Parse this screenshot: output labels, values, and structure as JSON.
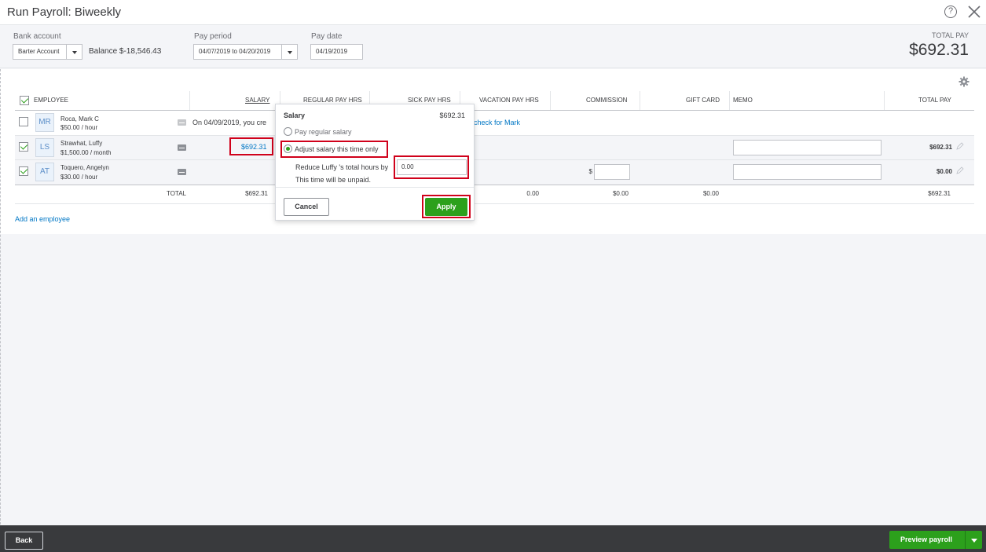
{
  "header": {
    "title": "Run Payroll: Biweekly",
    "help": "?"
  },
  "top": {
    "bank_account_label": "Bank account",
    "bank_account_value": "Barter Account",
    "balance": "Balance $-18,546.43",
    "pay_period_label": "Pay period",
    "pay_period_value": "04/07/2019 to 04/20/2019",
    "pay_date_label": "Pay date",
    "pay_date_value": "04/19/2019",
    "total_pay_label": "TOTAL PAY",
    "total_pay_value": "$692.31"
  },
  "table": {
    "columns": {
      "employee": "EMPLOYEE",
      "salary": "SALARY",
      "regular": "REGULAR PAY HRS",
      "sick": "SICK PAY HRS",
      "vacation": "VACATION PAY HRS",
      "commission": "COMMISSION",
      "gift": "GIFT CARD",
      "memo": "MEMO",
      "total": "TOTAL PAY"
    },
    "rows": [
      {
        "initials": "MR",
        "name": "Roca, Mark C",
        "rate": "$50.00 / hour",
        "note": "On 04/09/2019, you cre",
        "link": "check for Mark"
      },
      {
        "initials": "LS",
        "name": "Strawhat, Luffy",
        "rate": "$1,500.00 / month",
        "salary": "$692.31",
        "total": "$692.31"
      },
      {
        "initials": "AT",
        "name": "Toquero, Angelyn",
        "rate": "$30.00 / hour",
        "commission_prefix": "$",
        "total": "$0.00"
      }
    ],
    "totals": {
      "label": "TOTAL",
      "salary": "$692.31",
      "vacation": "0.00",
      "commission": "$0.00",
      "gift": "$0.00",
      "total": "$692.31"
    },
    "add_employee": "Add an employee"
  },
  "popover": {
    "title": "Salary",
    "amount": "$692.31",
    "option_regular": "Pay regular salary",
    "option_adjust": "Adjust salary this time only",
    "reduce_label": "Reduce Luffy 's total hours by",
    "reduce_value": "0.00",
    "unpaid_note": "This time will be unpaid.",
    "cancel": "Cancel",
    "apply": "Apply"
  },
  "footer": {
    "back": "Back",
    "preview": "Preview payroll"
  }
}
